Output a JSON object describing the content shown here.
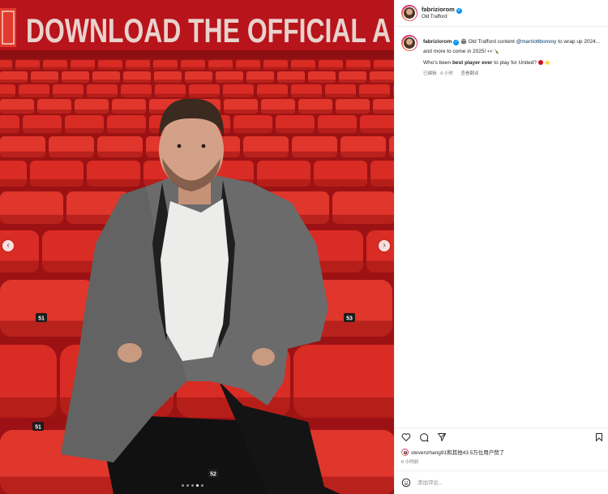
{
  "photo": {
    "banner_text": "DOWNLOAD THE OFFICIAL A",
    "seat_numbers": [
      "51",
      "53",
      "51",
      "52"
    ],
    "carousel_dots": 5,
    "active_dot": 3
  },
  "header": {
    "username": "fabriziorom",
    "location": "Old Trafford"
  },
  "caption": {
    "username": "fabriziorom",
    "text_part1": " Old Trafford content ",
    "mention": "@marriottbonvoy",
    "text_part2": " to wrap up 2024... and more to come in 2025! ",
    "question_prefix": "Who's been ",
    "question_bold": "best player ever",
    "question_suffix": " to play for United? ",
    "edited": "已编辑 · 6 小时",
    "translate": "查看翻译"
  },
  "likes": {
    "text": "stevenzhang91和其他43.5万位用户赞了"
  },
  "post_time": "6 小时前",
  "comment": {
    "placeholder": "添加评论..."
  },
  "icons": {
    "verified": "verified-badge-icon",
    "like": "heart-icon",
    "comment": "comment-bubble-icon",
    "share": "paper-plane-icon",
    "save": "bookmark-icon",
    "emoji": "smiley-icon"
  }
}
